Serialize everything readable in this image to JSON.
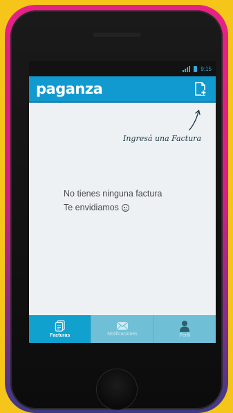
{
  "status_bar": {
    "time": "9:15"
  },
  "app_bar": {
    "logo": "paganza",
    "add_invoice_icon": "add-document-icon"
  },
  "hint": {
    "text": "Ingresá una Factura"
  },
  "empty_state": {
    "line1": "No tienes ninguna factura",
    "line2": "Te envidiamos"
  },
  "tabs": [
    {
      "label": "Facturas",
      "icon": "invoice-icon",
      "active": true
    },
    {
      "label": "Notificaciones",
      "icon": "envelope-icon",
      "active": false
    },
    {
      "label": "Perfil",
      "icon": "user-icon",
      "active": false
    }
  ],
  "colors": {
    "background": "#f6c51a",
    "case_top": "#e52284",
    "case_bottom": "#3d3a87",
    "app_bar": "#119ad0",
    "tab_active": "#11a1cf",
    "tab_inactive": "#6fc0d6"
  }
}
